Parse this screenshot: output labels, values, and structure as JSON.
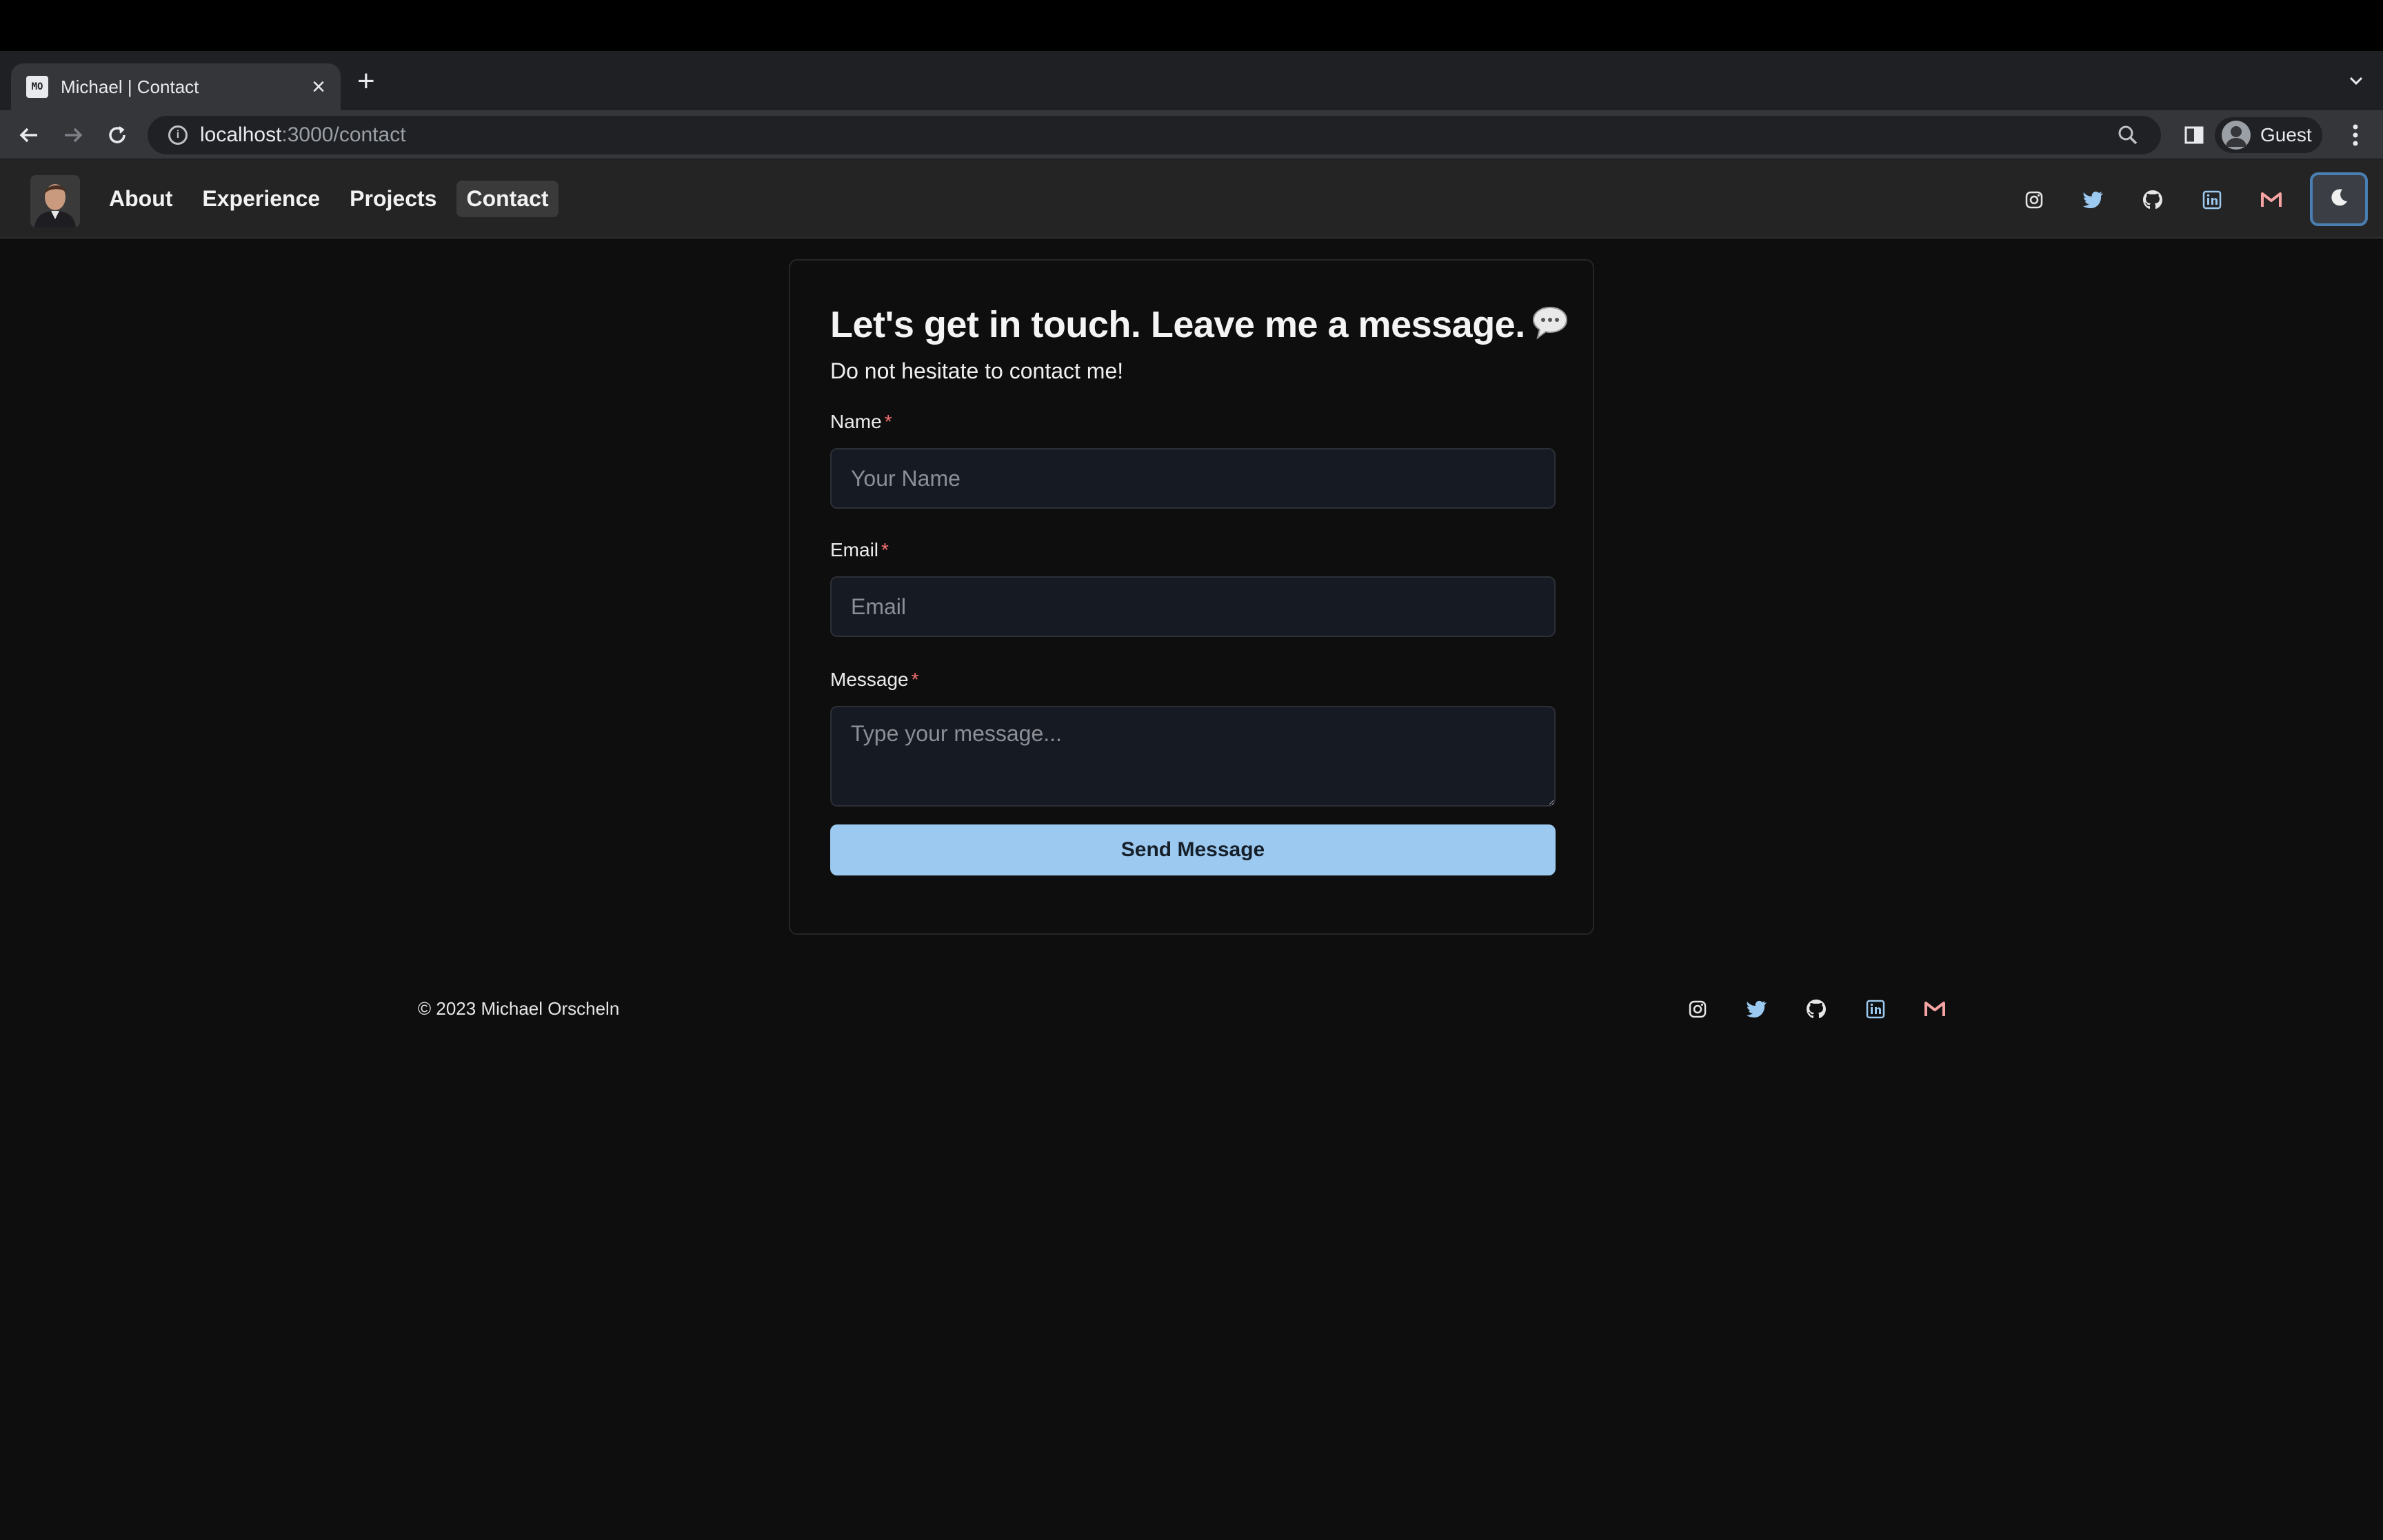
{
  "browser": {
    "tab_title": "Michael | Contact",
    "tab_favicon_text": "MO",
    "url_host": "localhost",
    "url_path": ":3000/contact",
    "profile_label": "Guest"
  },
  "header": {
    "nav": [
      {
        "label": "About"
      },
      {
        "label": "Experience"
      },
      {
        "label": "Projects"
      },
      {
        "label": "Contact",
        "active": true
      }
    ],
    "social_icons": [
      "instagram-icon",
      "twitter-icon",
      "github-icon",
      "linkedin-icon",
      "gmail-icon"
    ],
    "theme_toggle_icon": "moon-icon"
  },
  "contact": {
    "title": "Let's get in touch. Leave me a message.",
    "subtitle": "Do not hesitate to contact me!",
    "name_label": "Name",
    "name_placeholder": "Your Name",
    "email_label": "Email",
    "email_placeholder": "Email",
    "message_label": "Message",
    "message_placeholder": "Type your message...",
    "required_mark": "*",
    "submit_label": "Send Message"
  },
  "footer": {
    "copyright": "© 2023 Michael Orscheln",
    "social_icons": [
      "instagram-icon",
      "twitter-icon",
      "github-icon",
      "linkedin-icon",
      "gmail-icon"
    ]
  },
  "colors": {
    "page_bg": "#0e0e0e",
    "header_bg": "#242424",
    "twitter": "#9cc9ef",
    "linkedin": "#9cc9ef",
    "gmail": "#f5a3a3",
    "button": "#9cc9ef",
    "required": "#f87171"
  }
}
